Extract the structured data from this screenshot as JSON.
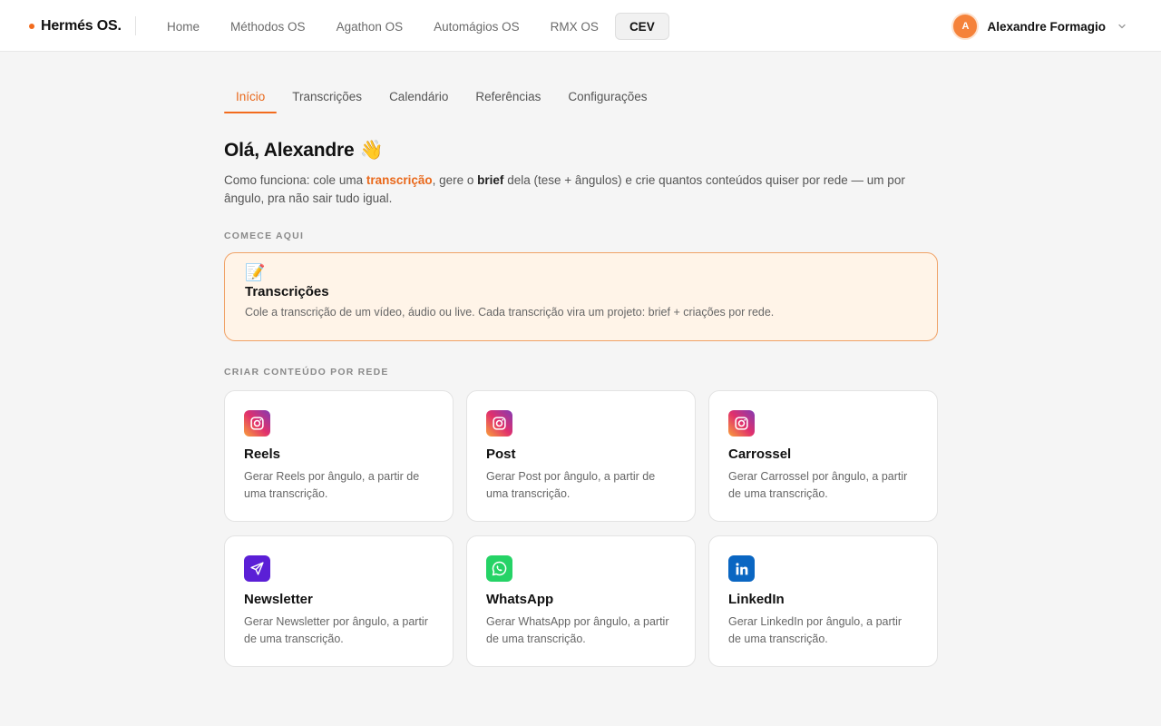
{
  "brand": {
    "name": "Hermés OS.",
    "accent": "#f26b1d"
  },
  "topnav": [
    {
      "label": "Home",
      "active": false
    },
    {
      "label": "Méthodos OS",
      "active": false
    },
    {
      "label": "Agathon OS",
      "active": false
    },
    {
      "label": "Automágios OS",
      "active": false
    },
    {
      "label": "RMX OS",
      "active": false
    },
    {
      "label": "CEV",
      "active": true
    }
  ],
  "user": {
    "initial": "A",
    "name": "Alexandre Formagio",
    "avatar_color": "#f5823a"
  },
  "tabs": [
    {
      "label": "Início",
      "active": true
    },
    {
      "label": "Transcrições",
      "active": false
    },
    {
      "label": "Calendário",
      "active": false
    },
    {
      "label": "Referências",
      "active": false
    },
    {
      "label": "Configurações",
      "active": false
    }
  ],
  "greeting": {
    "text": "Olá, Alexandre",
    "emoji": "👋"
  },
  "intro": {
    "p1": "Como funciona: cole uma ",
    "hl": "transcrição",
    "p2": ", gere o ",
    "strong": "brief",
    "p3": " dela (tese + ângulos) e crie quantos conteúdos quiser por rede — um por ângulo, pra não sair tudo igual."
  },
  "start_section": {
    "label": "COMECE AQUI",
    "card": {
      "emoji": "📝",
      "title": "Transcrições",
      "desc": "Cole a transcrição de um vídeo, áudio ou live. Cada transcrição vira um projeto: brief + criações por rede."
    }
  },
  "networks_section": {
    "label": "CRIAR CONTEÚDO POR REDE",
    "cards": [
      {
        "icon": "instagram-icon",
        "title": "Reels",
        "desc": "Gerar Reels por ângulo, a partir de uma transcrição."
      },
      {
        "icon": "instagram-icon",
        "title": "Post",
        "desc": "Gerar Post por ângulo, a partir de uma transcrição."
      },
      {
        "icon": "instagram-icon",
        "title": "Carrossel",
        "desc": "Gerar Carrossel por ângulo, a partir de uma transcrição."
      },
      {
        "icon": "send-icon",
        "title": "Newsletter",
        "desc": "Gerar Newsletter por ângulo, a partir de uma transcrição."
      },
      {
        "icon": "whatsapp-icon",
        "title": "WhatsApp",
        "desc": "Gerar WhatsApp por ângulo, a partir de uma transcrição."
      },
      {
        "icon": "linkedin-icon",
        "title": "LinkedIn",
        "desc": "Gerar LinkedIn por ângulo, a partir de uma transcrição."
      }
    ]
  }
}
